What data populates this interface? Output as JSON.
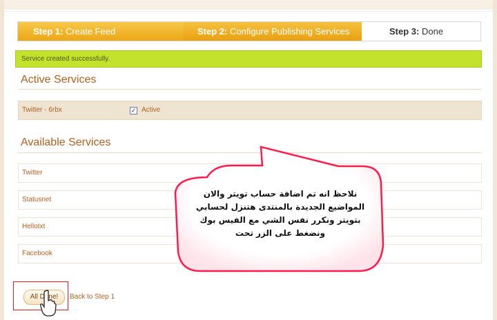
{
  "wizard": {
    "steps": [
      {
        "num": "Step 1:",
        "label": "Create Feed"
      },
      {
        "num": "Step 2:",
        "label": "Configure Publishing Services"
      },
      {
        "num": "Step 3:",
        "label": "Done"
      }
    ]
  },
  "banner": {
    "message": "Service created successfully."
  },
  "active_services": {
    "title": "Active Services",
    "items": [
      {
        "name": "Twitter - 6rbx",
        "checked": true,
        "status_label": "Active"
      }
    ]
  },
  "available_services": {
    "title": "Available Services",
    "items": [
      "Twitter",
      "Statusnet",
      "Hellotxt",
      "Facebook"
    ]
  },
  "callout": {
    "lines": [
      "نلاحظ انه تم اضافة حساب تويتر والان",
      "المواضيع الجديدة بالمنتدى هتنزل لحسابي",
      "بتويتر ونكرر نفس الشي مع الفيس بوك",
      "ونضغط على الزر تحت"
    ],
    "color": "#ff1a4b"
  },
  "footer": {
    "all_done_label": "All Done!",
    "back_label": "Back to Step 1"
  },
  "icons": {
    "checkbox": "checkmark-icon",
    "cursor": "hand-pointer-icon"
  }
}
